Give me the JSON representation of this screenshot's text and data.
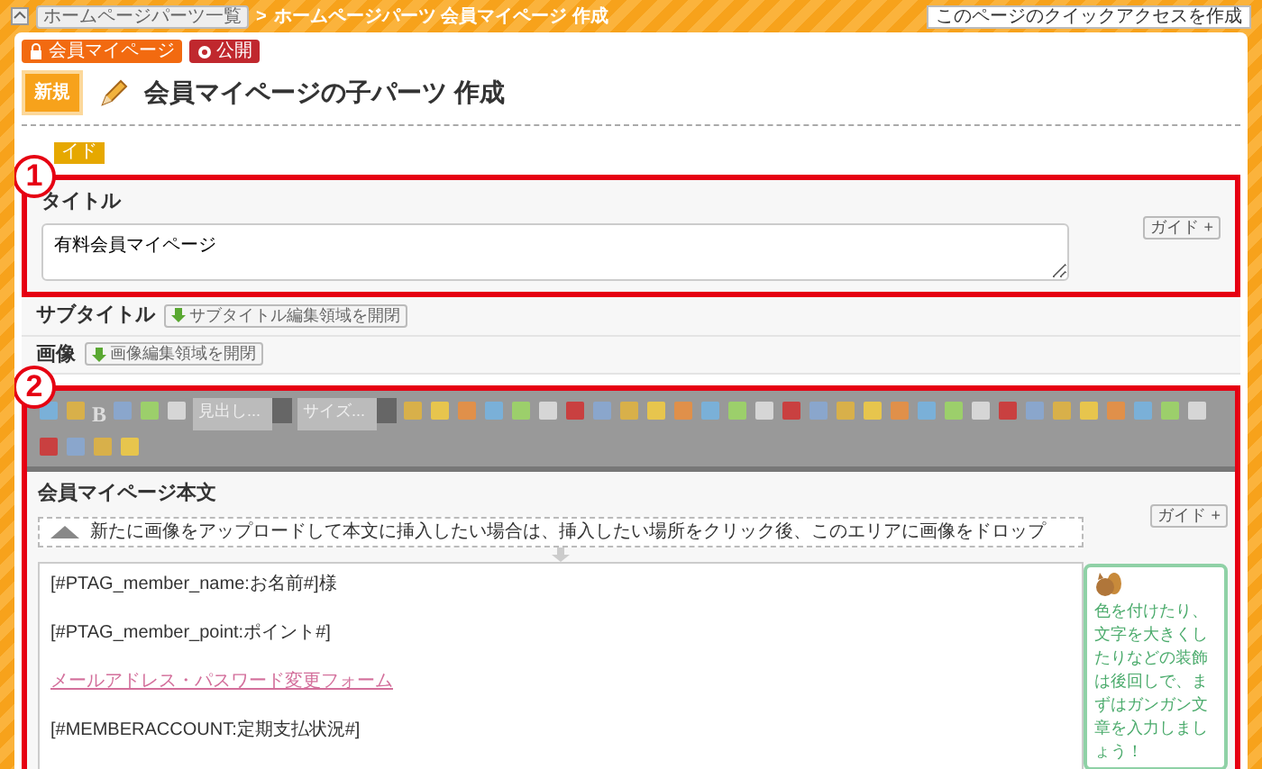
{
  "breadcrumb": {
    "parent": "ホームページパーツ一覧",
    "separator": ">",
    "current": "ホームページパーツ 会員マイページ 作成"
  },
  "quick_access": "このページのクイックアクセスを作成",
  "badges": [
    {
      "label": "会員マイページ",
      "kind": "members"
    },
    {
      "label": "公開",
      "kind": "public"
    }
  ],
  "heading": {
    "badge": "新規",
    "title": "会員マイページの子パーツ 作成"
  },
  "guide_tag": "イド",
  "annotations": [
    "1",
    "2"
  ],
  "title_field": {
    "label": "タイトル",
    "value": "有料会員マイページ",
    "guide": "ガイド +"
  },
  "subtitle": {
    "label": "サブタイトル",
    "button": "サブタイトル編集領域を開閉"
  },
  "image": {
    "label": "画像",
    "button": "画像編集領域を開閉"
  },
  "editor": {
    "bold": "B",
    "heading_select": "見出し...",
    "size_select": "サイズ...",
    "body_label": "会員マイページ本文",
    "drop_hint": "新たに画像をアップロードして本文に挿入したい場合は、挿入したい場所をクリック後、このエリアに画像をドロップ",
    "guide": "ガイド +",
    "lines": [
      {
        "kind": "text",
        "text": "[#PTAG_member_name:お名前#]様"
      },
      {
        "kind": "text",
        "text": "[#PTAG_member_point:ポイント#]"
      },
      {
        "kind": "link",
        "text": "メールアドレス・パスワード変更フォーム"
      },
      {
        "kind": "text",
        "text": "[#MEMBERACCOUNT:定期支払状況#]"
      }
    ],
    "tip": "色を付けたり、文字を大きくしたりなどの装飾は後回しで、まずはガンガン文章を入力しましょう！"
  }
}
